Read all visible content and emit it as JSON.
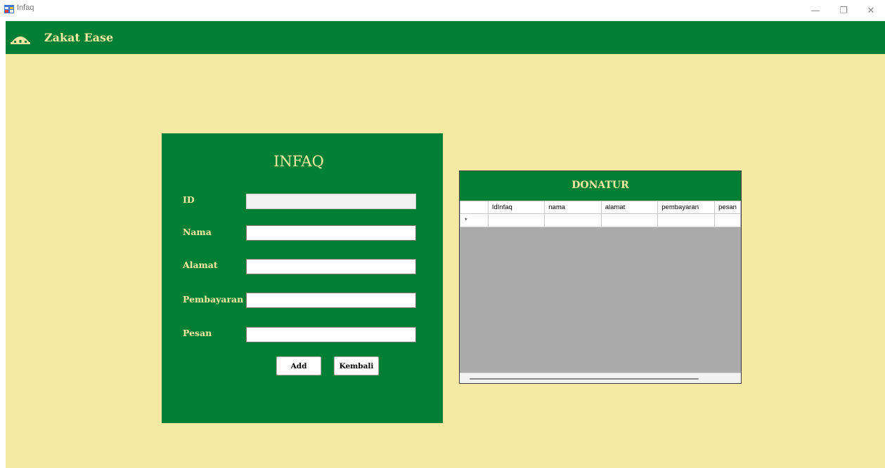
{
  "window": {
    "title": "Infaq",
    "minimize_glyph": "—",
    "maximize_glyph": "❐",
    "close_glyph": "✕"
  },
  "app": {
    "brand": "Zakat Ease",
    "logo_icon": "mosque-dome-icon"
  },
  "form": {
    "title": "INFAQ",
    "fields": [
      {
        "label": "ID",
        "value": ""
      },
      {
        "label": "Nama",
        "value": ""
      },
      {
        "label": "Alamat",
        "value": ""
      },
      {
        "label": "Pembayaran",
        "value": ""
      },
      {
        "label": "Pesan",
        "value": ""
      }
    ],
    "add_label": "Add",
    "back_label": "Kembali"
  },
  "grid": {
    "title": "DONATUR",
    "columns": [
      "IdInfaq",
      "nama",
      "alamat",
      "pembayaran",
      "pesan"
    ],
    "new_row_marker": "*"
  },
  "colors": {
    "primary_green": "#007f35",
    "background_cream": "#f4e9a3",
    "grid_empty": "#ababab"
  }
}
